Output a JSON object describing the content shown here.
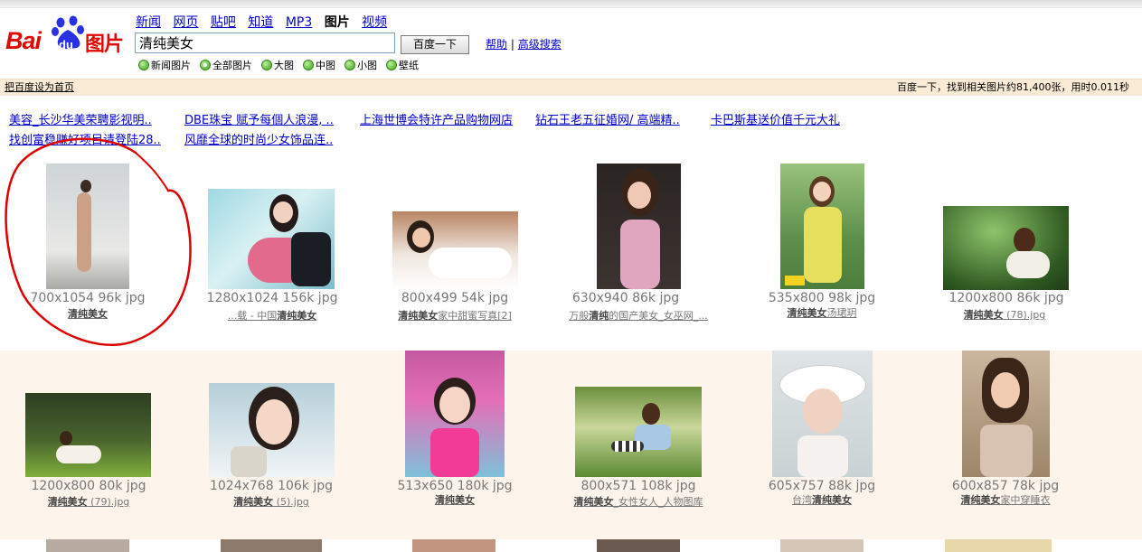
{
  "nav": {
    "links": [
      "新闻",
      "网页",
      "贴吧",
      "知道",
      "MP3",
      "图片",
      "视频"
    ],
    "current_index": 5
  },
  "logo": {
    "bai": "Bai",
    "du": "du",
    "section": "图片"
  },
  "search": {
    "value": "清纯美女",
    "button": "百度一下"
  },
  "help": {
    "help": "帮助",
    "sep": "|",
    "advanced": "高级搜索"
  },
  "filters": [
    {
      "label": "新闻图片",
      "checked": false
    },
    {
      "label": "全部图片",
      "checked": true
    },
    {
      "label": "大图",
      "checked": false
    },
    {
      "label": "中图",
      "checked": false
    },
    {
      "label": "小图",
      "checked": false
    },
    {
      "label": "壁纸",
      "checked": false
    }
  ],
  "bar": {
    "left": "把百度设为首页",
    "right": "百度一下，找到相关图片约81,400张，用时0.011秒"
  },
  "ads": [
    "美容_长沙华美荣聘影视明..",
    "DBE珠宝 赋予每個人浪漫, ..",
    "上海世博会特许产品购物网店",
    "钻石王老五征婚网/ 高端精..",
    "卡巴斯基送价值千元大礼",
    "找创富稳赚好项目请登陆28..",
    "风靡全球的时尚少女饰品连.."
  ],
  "row1": [
    {
      "meta": "700x1054 96k jpg",
      "cap_pre": "",
      "cap_b": "清纯美女",
      "cap_post": ""
    },
    {
      "meta": "1280x1024 156k jpg",
      "cap_pre": "...载 - 中国",
      "cap_b": "清纯美女",
      "cap_post": ""
    },
    {
      "meta": "800x499 54k jpg",
      "cap_pre": "",
      "cap_b": "清纯美女",
      "cap_post": "家中甜蜜写真[2]"
    },
    {
      "meta": "630x940 86k jpg",
      "cap_pre": "万般",
      "cap_b": "清纯",
      "cap_post": "的国产美女_女巫网_..."
    },
    {
      "meta": "535x800 98k jpg",
      "cap_pre": "",
      "cap_b": "清纯美女",
      "cap_post": "汤珺玥"
    },
    {
      "meta": "1200x800 86k jpg",
      "cap_pre": "",
      "cap_b": "清纯美女",
      "cap_post": " (78).jpg"
    }
  ],
  "row2": [
    {
      "meta": "1200x800 80k jpg",
      "cap_pre": "",
      "cap_b": "清纯美女",
      "cap_post": " (79).jpg"
    },
    {
      "meta": "1024x768 106k jpg",
      "cap_pre": "",
      "cap_b": "清纯美女",
      "cap_post": " (5).jpg"
    },
    {
      "meta": "513x650 180k jpg",
      "cap_pre": "",
      "cap_b": "清纯美女",
      "cap_post": ""
    },
    {
      "meta": "800x571 108k jpg",
      "cap_pre": "",
      "cap_b": "清纯美女",
      "cap_post": "_女性女人_人物图库"
    },
    {
      "meta": "605x757 88k jpg",
      "cap_pre": "台湾",
      "cap_b": "清纯美女",
      "cap_post": ""
    },
    {
      "meta": "600x857 78k jpg",
      "cap_pre": "",
      "cap_b": "清纯美女",
      "cap_post": "家中穿睡衣"
    }
  ],
  "colors": {
    "link": "#0000cc",
    "brand_red": "#e10601",
    "bar_bg": "#faebd7",
    "circle": "#dd0000"
  },
  "icons": [
    "baidu-paw-icon",
    "radio-button-icon"
  ]
}
